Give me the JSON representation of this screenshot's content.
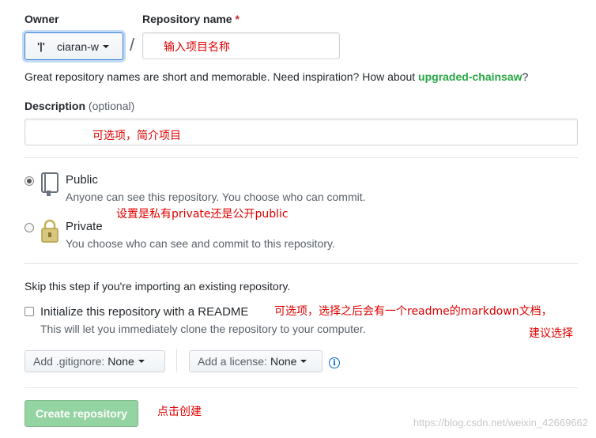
{
  "owner": {
    "label": "Owner",
    "avatar_glyph": "'|'",
    "selected": "ciaran-w"
  },
  "repo_name": {
    "label": "Repository name",
    "required_mark": "*",
    "separator": "/",
    "annotation": "输入项目名称"
  },
  "name_hint": {
    "text": "Great repository names are short and memorable. Need inspiration? How about ",
    "suggestion": "upgraded-chainsaw",
    "suffix": "?"
  },
  "description": {
    "label": "Description",
    "optional": "(optional)",
    "annotation": "可选项，简介项目"
  },
  "visibility": {
    "public_title": "Public",
    "public_desc": "Anyone can see this repository. You choose who can commit.",
    "annotation": "设置是私有private还是公开public",
    "private_title": "Private",
    "private_desc": "You choose who can see and commit to this repository."
  },
  "init": {
    "skip_text": "Skip this step if you're importing an existing repository.",
    "readme_label": "Initialize this repository with a README",
    "readme_desc": "This will let you immediately clone the repository to your computer.",
    "annotation_line1": "可选项，选择之后会有一个readme的markdown文档，",
    "annotation_line2": "建议选择"
  },
  "gitignore": {
    "prefix": "Add .gitignore:",
    "value": "None"
  },
  "license": {
    "prefix": "Add a license:",
    "value": "None"
  },
  "create": {
    "label": "Create repository",
    "annotation": "点击创建"
  },
  "watermark": "https://blog.csdn.net/weixin_42669662",
  "colors": {
    "annotation": "#e00000",
    "suggestion": "#28a745",
    "create_button": "#94d3a2",
    "focus_border": "#3c83d5"
  },
  "icons": {
    "public": "repo-book-icon",
    "private": "lock-icon",
    "license_info": "info-icon"
  }
}
